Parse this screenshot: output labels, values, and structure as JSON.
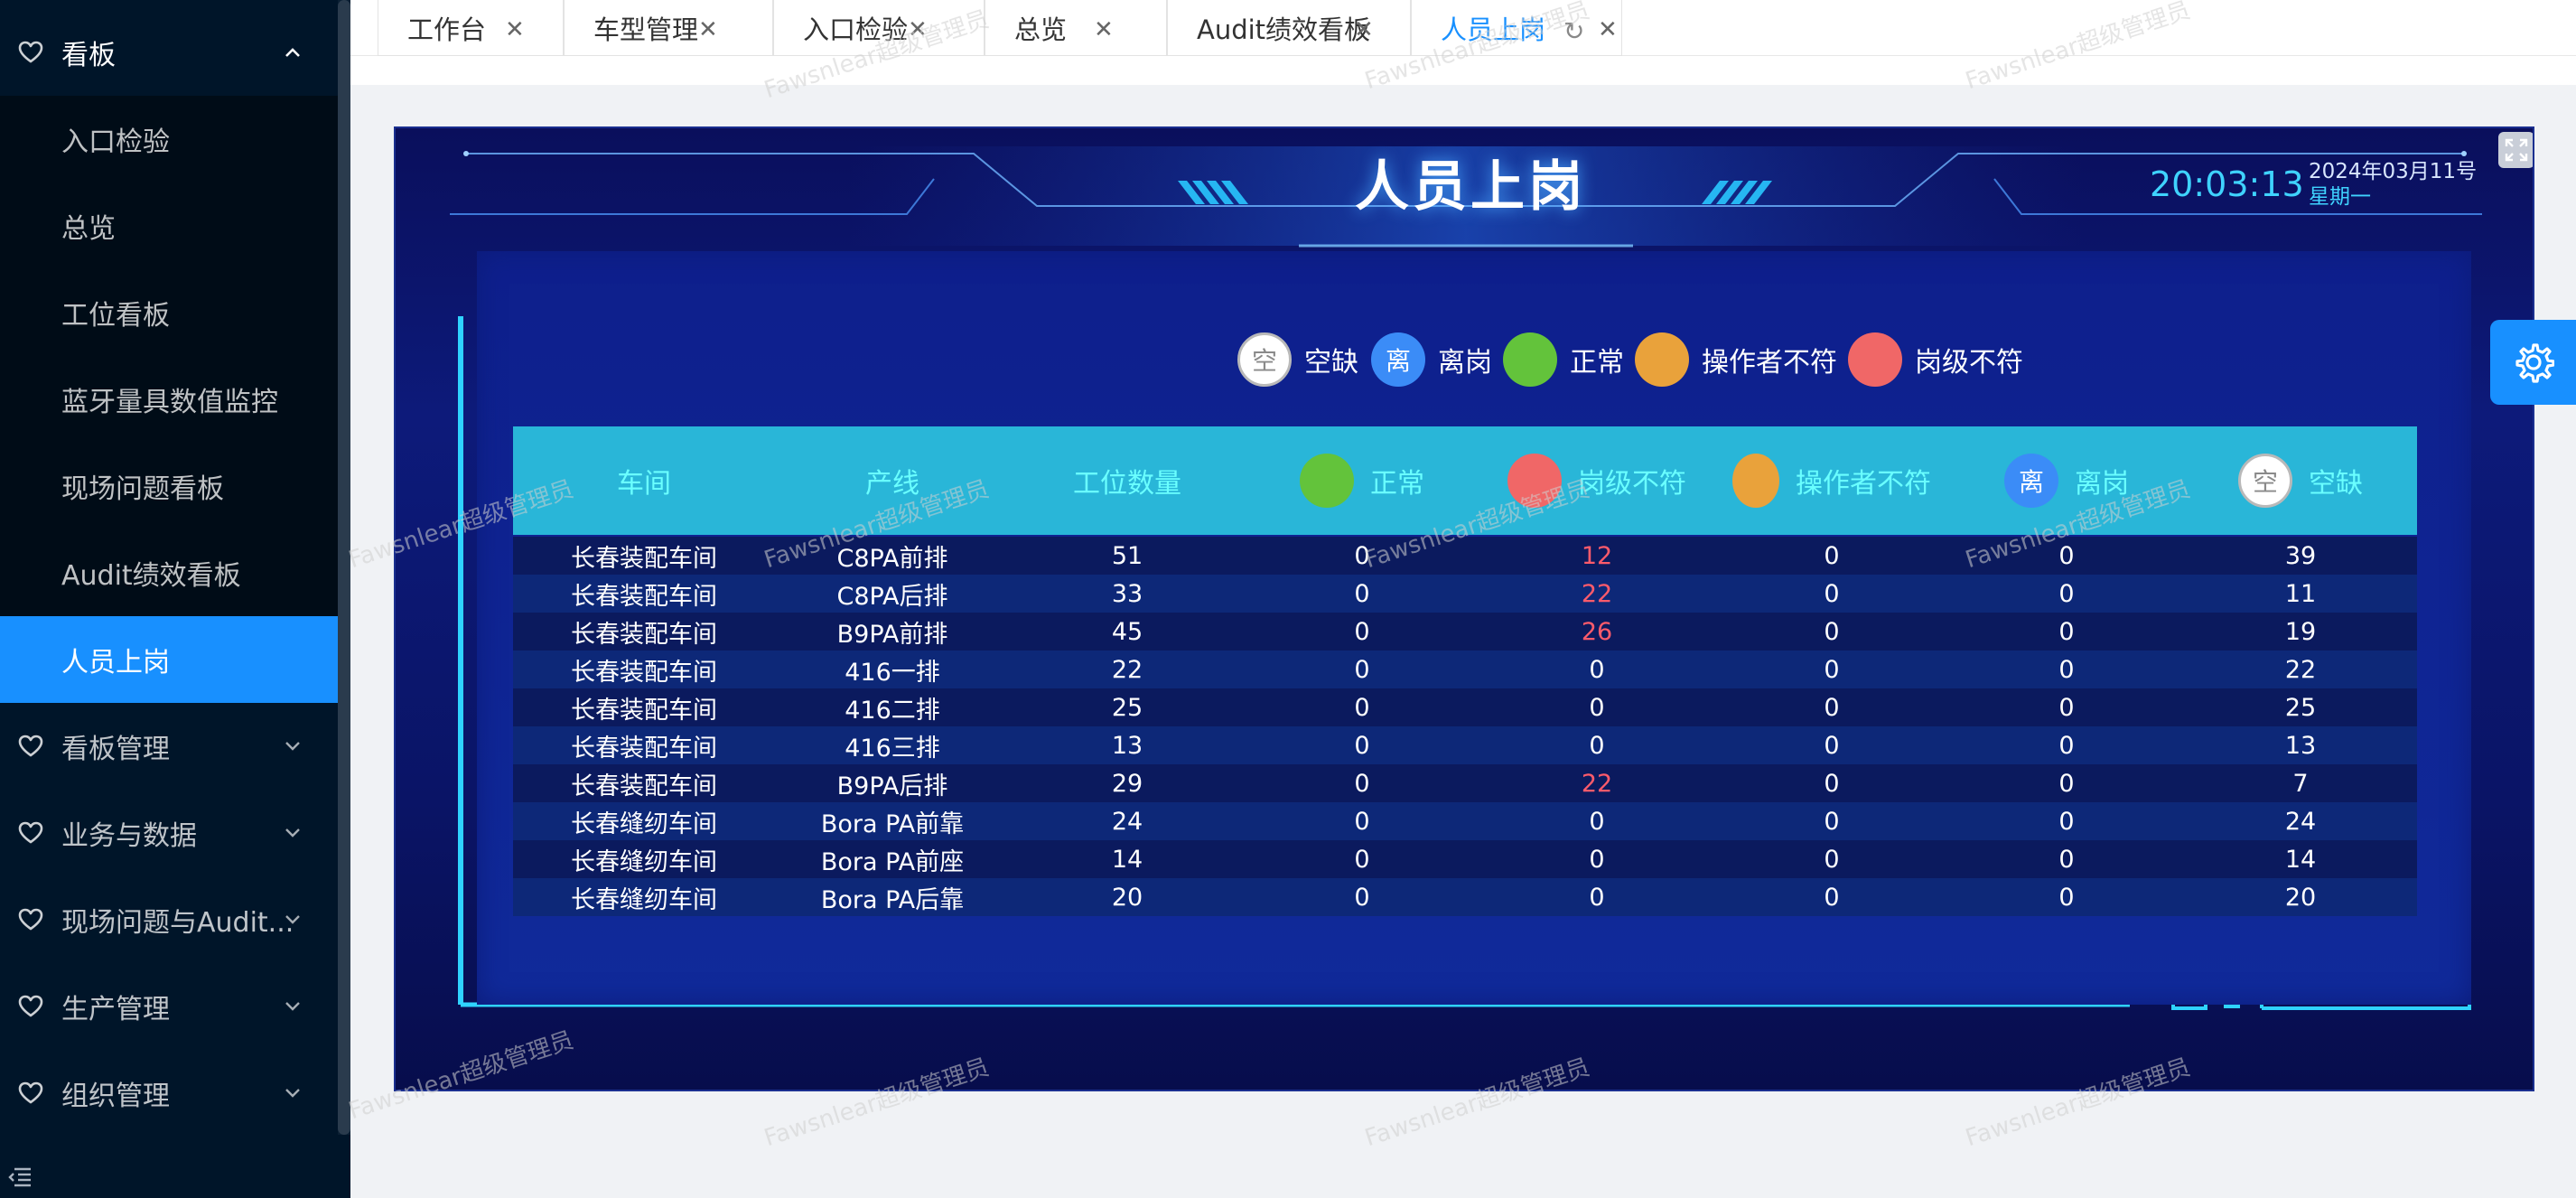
{
  "sidebar": {
    "items": [
      {
        "label": "看板",
        "type": "group",
        "icon": "heart-icon",
        "open": true
      },
      {
        "label": "入口检验",
        "type": "sub"
      },
      {
        "label": "总览",
        "type": "sub"
      },
      {
        "label": "工位看板",
        "type": "sub"
      },
      {
        "label": "蓝牙量具数值监控",
        "type": "sub"
      },
      {
        "label": "现场问题看板",
        "type": "sub"
      },
      {
        "label": "Audit绩效看板",
        "type": "sub"
      },
      {
        "label": "人员上岗",
        "type": "sub",
        "active": true
      },
      {
        "label": "看板管理",
        "type": "group",
        "icon": "heart-icon"
      },
      {
        "label": "业务与数据",
        "type": "group",
        "icon": "heart-icon"
      },
      {
        "label": "现场问题与Audit...",
        "type": "group",
        "icon": "heart-icon"
      },
      {
        "label": "生产管理",
        "type": "group",
        "icon": "heart-icon"
      },
      {
        "label": "组织管理",
        "type": "group",
        "icon": "heart-icon"
      }
    ],
    "collapse_icon": "menu-fold-icon"
  },
  "tabs": [
    {
      "label": "工作台"
    },
    {
      "label": "车型管理"
    },
    {
      "label": "入口检验"
    },
    {
      "label": "总览"
    },
    {
      "label": "Audit绩效看板"
    },
    {
      "label": "人员上岗",
      "active": true
    }
  ],
  "board": {
    "title": "人员上岗",
    "time": "20:03:13",
    "date": "2024年03月11号",
    "weekday": "星期一",
    "legend": [
      {
        "symbol": "空",
        "label": "空缺",
        "color": "#ffffff"
      },
      {
        "symbol": "离",
        "label": "离岗",
        "color": "#3b8cf7"
      },
      {
        "symbol": "",
        "label": "正常",
        "color": "#63c33b"
      },
      {
        "symbol": "",
        "label": "操作者不符",
        "color": "#e9a23b"
      },
      {
        "symbol": "",
        "label": "岗级不符",
        "color": "#f06767"
      }
    ],
    "columns": {
      "workshop": "车间",
      "line": "产线",
      "count": "工位数量",
      "normal": "正常",
      "grade": "岗级不符",
      "operator": "操作者不符",
      "leave": "离岗",
      "empty": "空缺",
      "leave_symbol": "离",
      "empty_symbol": "空"
    },
    "rows": [
      {
        "workshop": "长春装配车间",
        "line": "C8PA前排",
        "count": "51",
        "normal": "0",
        "grade": "12",
        "operator": "0",
        "leave": "0",
        "empty": "39"
      },
      {
        "workshop": "长春装配车间",
        "line": "C8PA后排",
        "count": "33",
        "normal": "0",
        "grade": "22",
        "operator": "0",
        "leave": "0",
        "empty": "11"
      },
      {
        "workshop": "长春装配车间",
        "line": "B9PA前排",
        "count": "45",
        "normal": "0",
        "grade": "26",
        "operator": "0",
        "leave": "0",
        "empty": "19"
      },
      {
        "workshop": "长春装配车间",
        "line": "416一排",
        "count": "22",
        "normal": "0",
        "grade": "0",
        "operator": "0",
        "leave": "0",
        "empty": "22"
      },
      {
        "workshop": "长春装配车间",
        "line": "416二排",
        "count": "25",
        "normal": "0",
        "grade": "0",
        "operator": "0",
        "leave": "0",
        "empty": "25"
      },
      {
        "workshop": "长春装配车间",
        "line": "416三排",
        "count": "13",
        "normal": "0",
        "grade": "0",
        "operator": "0",
        "leave": "0",
        "empty": "13"
      },
      {
        "workshop": "长春装配车间",
        "line": "B9PA后排",
        "count": "29",
        "normal": "0",
        "grade": "22",
        "operator": "0",
        "leave": "0",
        "empty": "7"
      },
      {
        "workshop": "长春缝纫车间",
        "line": "Bora PA前靠",
        "count": "24",
        "normal": "0",
        "grade": "0",
        "operator": "0",
        "leave": "0",
        "empty": "24"
      },
      {
        "workshop": "长春缝纫车间",
        "line": "Bora PA前座",
        "count": "14",
        "normal": "0",
        "grade": "0",
        "operator": "0",
        "leave": "0",
        "empty": "14"
      },
      {
        "workshop": "长春缝纫车间",
        "line": "Bora PA后靠",
        "count": "20",
        "normal": "0",
        "grade": "0",
        "operator": "0",
        "leave": "0",
        "empty": "20"
      }
    ],
    "alert_color": "#ff5b6b"
  },
  "watermark": "Fawsnlear超级管理员"
}
